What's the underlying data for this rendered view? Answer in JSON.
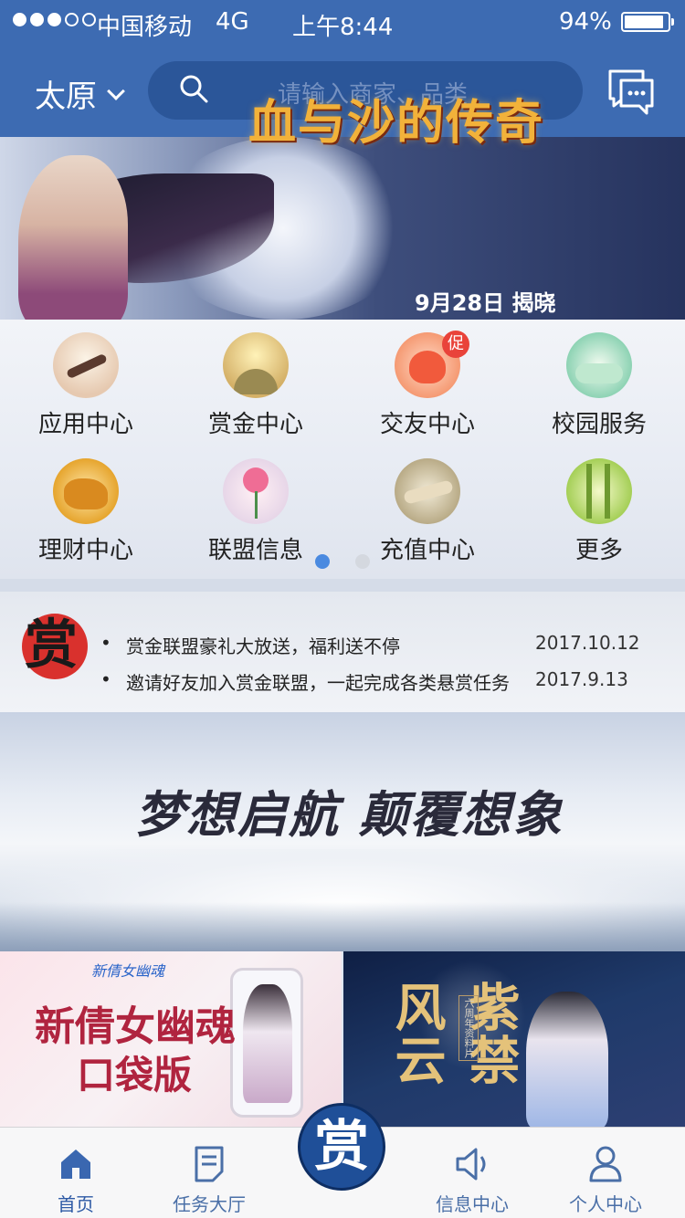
{
  "status_bar": {
    "carrier": "中国移动",
    "network": "4G",
    "time": "上午8:44",
    "battery": "94%",
    "battery_level": 0.94,
    "signal_bars_full": 3,
    "signal_bars_total": 5
  },
  "header": {
    "city": "太原",
    "search_placeholder": "请输入商家、品类",
    "accent_color": "#3d6bb2"
  },
  "banner": {
    "title": "血与沙的传奇",
    "date_text": "9月28日 揭晓"
  },
  "grid": {
    "items": [
      {
        "label": "应用中心",
        "icon": "app-center-icon"
      },
      {
        "label": "赏金中心",
        "icon": "bounty-center-icon"
      },
      {
        "label": "交友中心",
        "icon": "friends-center-icon",
        "badge": "促"
      },
      {
        "label": "校园服务",
        "icon": "campus-service-icon"
      },
      {
        "label": "理财中心",
        "icon": "finance-center-icon"
      },
      {
        "label": "联盟信息",
        "icon": "alliance-info-icon"
      },
      {
        "label": "充值中心",
        "icon": "recharge-center-icon"
      },
      {
        "label": "更多",
        "icon": "more-icon"
      }
    ],
    "pages_total": 2,
    "current_page": 1
  },
  "notice": {
    "seal_char": "赏",
    "items": [
      {
        "bullet": "•",
        "text": "赏金联盟豪礼大放送，福利送不停",
        "date": "2017.10.12"
      },
      {
        "bullet": "•",
        "text": "邀请好友加入赏金联盟，一起完成各类悬赏任务",
        "date": "2017.9.13"
      }
    ]
  },
  "slogan": {
    "text": "梦想启航 颠覆想象"
  },
  "promos": {
    "left": {
      "logo": "新倩女幽魂",
      "title_line1": "新倩女幽魂",
      "title_line2": "口袋版"
    },
    "right": {
      "title": "紫禁风云",
      "subtitle": "六周年资料片"
    }
  },
  "tabbar": {
    "items": [
      {
        "label": "首页",
        "icon": "home-icon",
        "active": true
      },
      {
        "label": "任务大厅",
        "icon": "task-hall-icon",
        "active": false
      },
      {
        "label": "信息中心",
        "icon": "info-center-icon",
        "active": false
      },
      {
        "label": "个人中心",
        "icon": "profile-icon",
        "active": false
      }
    ],
    "center_label": "赏"
  }
}
